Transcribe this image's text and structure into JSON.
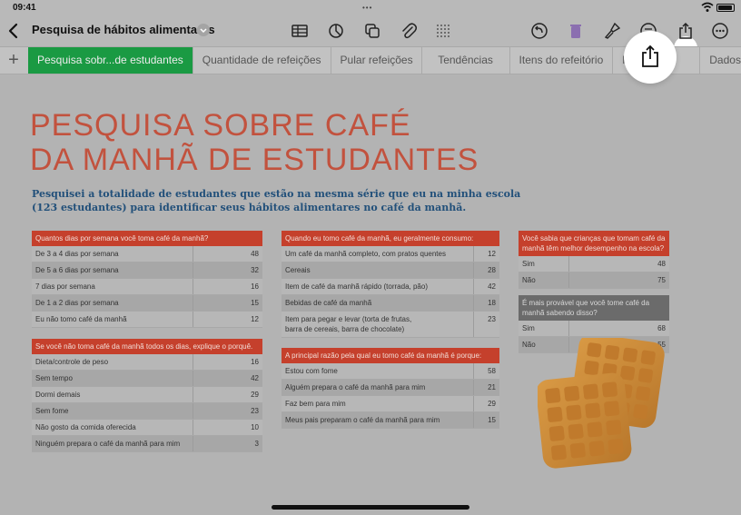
{
  "status": {
    "time": "09:41"
  },
  "toolbar": {
    "title": "Pesquisa de hábitos alimentares"
  },
  "tabs": [
    {
      "label": "Pesquisa sobr...de estudantes",
      "active": true
    },
    {
      "label": "Quantidade de refeições",
      "active": false
    },
    {
      "label": "Pular refeições",
      "active": false
    },
    {
      "label": "Tendências",
      "active": false
    },
    {
      "label": "Itens do refeitório",
      "active": false
    },
    {
      "label": "Prato",
      "active": false
    },
    {
      "label": "Dados nutr",
      "active": false
    }
  ],
  "page": {
    "title_line1": "PESQUISA SOBRE CAFÉ",
    "title_line2": "DA MANHÃ DE ESTUDANTES",
    "subtitle": "Pesquisei a totalidade de estudantes que estão na mesma série que eu na minha escola (123 estudantes) para identificar seus hábitos alimentares no café da manhã."
  },
  "tables": {
    "freq": {
      "header": "Quantos dias por semana você toma café da manhã?",
      "rows": [
        {
          "label": "De 3 a 4 dias por semana",
          "value": "48"
        },
        {
          "label": "De 5 a 6 dias por semana",
          "value": "32"
        },
        {
          "label": "7 dias por semana",
          "value": "16"
        },
        {
          "label": "De 1 a 2 dias por semana",
          "value": "15"
        },
        {
          "label": "Eu não tomo café da manhã",
          "value": "12"
        }
      ]
    },
    "reason_skip": {
      "header": "Se você não toma café da manhã todos os dias, explique o porquê.",
      "rows": [
        {
          "label": "Dieta/controle de peso",
          "value": "16"
        },
        {
          "label": "Sem tempo",
          "value": "42"
        },
        {
          "label": "Dormi demais",
          "value": "29"
        },
        {
          "label": "Sem fome",
          "value": "23"
        },
        {
          "label": "Não gosto da comida oferecida",
          "value": "10"
        },
        {
          "label": "Ninguém prepara o café da manhã para mim",
          "value": "3"
        }
      ]
    },
    "consume": {
      "header": "Quando eu tomo café da manhã, eu geralmente consumo:",
      "rows": [
        {
          "label": "Um café da manhã completo, com pratos quentes",
          "value": "12"
        },
        {
          "label": "Cereais",
          "value": "28"
        },
        {
          "label": "Item de café da manhã rápido (torrada, pão)",
          "value": "42"
        },
        {
          "label": "Bebidas de café da manhã",
          "value": "18"
        },
        {
          "label": "Item para pegar e levar (torta de frutas, barra de cereais, barra de chocolate)",
          "value": "23"
        }
      ]
    },
    "main_reason": {
      "header": "A principal razão pela qual eu tomo café da manhã é porque:",
      "rows": [
        {
          "label": "Estou com fome",
          "value": "58"
        },
        {
          "label": "Alguém prepara o café da manhã para mim",
          "value": "21"
        },
        {
          "label": "Faz bem para mim",
          "value": "29"
        },
        {
          "label": "Meus pais preparam o café da manhã para mim",
          "value": "15"
        }
      ]
    },
    "knew": {
      "header": "Você sabia que crianças que tomam café da manhã têm melhor desempenho na escola?",
      "rows": [
        {
          "label": "Sim",
          "value": "48"
        },
        {
          "label": "Não",
          "value": "75"
        }
      ]
    },
    "likely": {
      "header": "É mais provável que você tome café da manhã sabendo disso?",
      "rows": [
        {
          "label": "Sim",
          "value": "68"
        },
        {
          "label": "Não",
          "value": "55"
        }
      ]
    }
  },
  "icons": {
    "back": "chevron-left-icon",
    "title_menu": "chevron-down-icon",
    "table": "table-icon",
    "chart": "chart-icon",
    "shape": "shape-icon",
    "media": "paperclip-icon",
    "format": "format-icon",
    "undo": "undo-icon",
    "trash": "trash-icon",
    "brush": "brush-icon",
    "comment": "comment-icon",
    "share": "share-icon",
    "more": "more-icon"
  },
  "colors": {
    "accent_tab": "#1a9a43",
    "title": "#c2523e",
    "subtitle": "#22507a",
    "table_header": "#c5402c"
  }
}
